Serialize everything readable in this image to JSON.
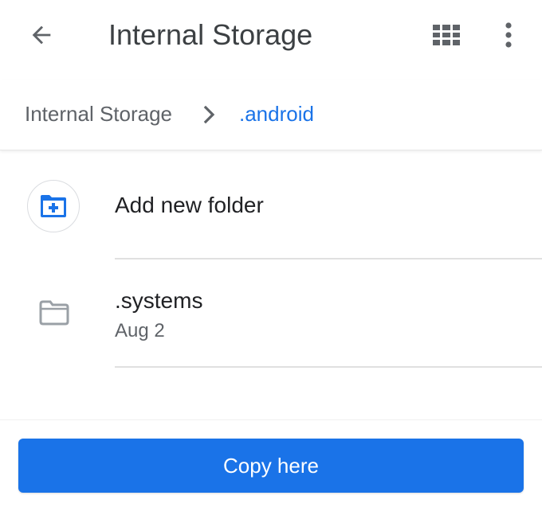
{
  "header": {
    "title": "Internal Storage",
    "back_icon": "arrow-back-icon",
    "view_icon": "grid-view-icon",
    "more_icon": "more-vert-icon"
  },
  "breadcrumb": {
    "root": "Internal Storage",
    "separator_icon": "chevron-right-icon",
    "current": ".android"
  },
  "list": {
    "add_folder": {
      "label": "Add new folder",
      "icon": "create-new-folder-icon"
    },
    "items": [
      {
        "name": ".systems",
        "date": "Aug 2",
        "icon": "folder-icon"
      }
    ]
  },
  "actions": {
    "copy_label": "Copy here"
  },
  "colors": {
    "accent": "#1a73e8",
    "icon_gray": "#5f6368",
    "folder_gray": "#9aa0a6",
    "divider": "#e0e0e0"
  }
}
